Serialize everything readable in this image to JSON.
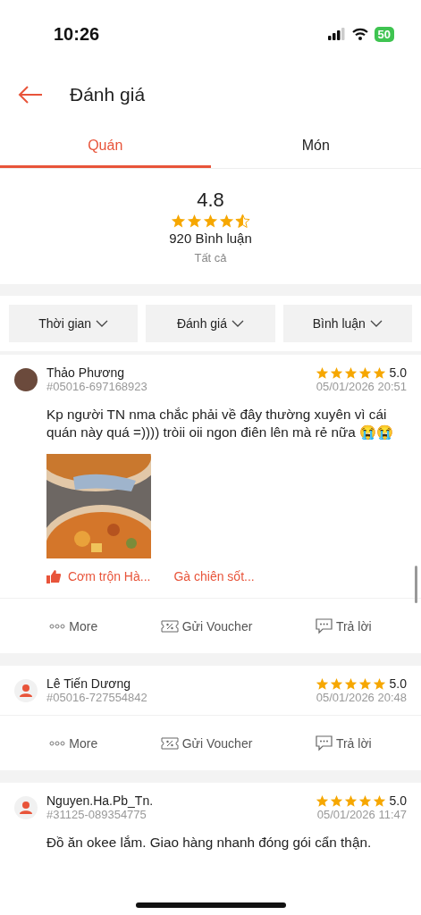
{
  "status_bar": {
    "time": "10:26",
    "battery": "50"
  },
  "header": {
    "title": "Đánh giá"
  },
  "tabs": [
    {
      "label": "Quán",
      "selected": true
    },
    {
      "label": "Món",
      "selected": false
    }
  ],
  "summary": {
    "score": "4.8",
    "stars": 4.5,
    "count": "920 Bình luận",
    "filter": "Tất cả"
  },
  "filters": [
    "Thời gian",
    "Đánh giá",
    "Bình luận"
  ],
  "reviews": [
    {
      "name": "Thảo Phương",
      "order": "#05016-697168923",
      "stars": 5,
      "score": "5.0",
      "date": "05/01/2026 20:51",
      "text": "Kp người TN nma chắc phải về đây thường xuyên vì cái quán này quá =)))) tròii oii ngon điên lên mà rẻ nữa 😭😭",
      "dishes": [
        "Cơm trộn Hà...",
        "Gà chiên sốt..."
      ],
      "actions": [
        "More",
        "Gửi Voucher",
        "Trả lời"
      ]
    },
    {
      "avatar": {
        "kind": "silhouette"
      },
      "name": "Lê Tiến Dương",
      "order": "#05016-727554842",
      "stars": 5,
      "score": "5.0",
      "date": "05/01/2026 20:48",
      "actions": [
        "More",
        "Gửi Voucher",
        "Trả lời"
      ]
    },
    {
      "avatar": {
        "kind": "silhouette"
      },
      "name": "Nguyen.Ha.Pb_Tn.",
      "order": "#31125-089354775",
      "stars": 5,
      "score": "5.0",
      "date": "05/01/2026 11:47",
      "text": "Đồ ăn okee lắm. Giao hàng nhanh đóng gói cẩn thận."
    }
  ]
}
